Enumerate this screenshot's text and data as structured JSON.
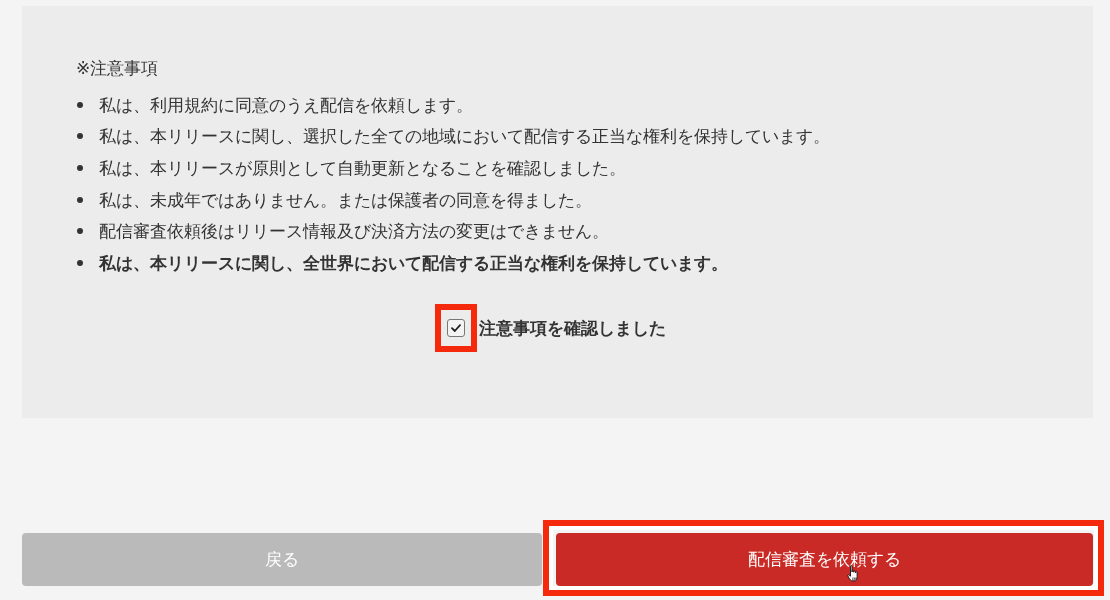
{
  "notice": {
    "title": "※注意事項",
    "items": [
      {
        "text": "私は、利用規約に同意のうえ配信を依頼します。",
        "bold": false
      },
      {
        "text": "私は、本リリースに関し、選択した全ての地域において配信する正当な権利を保持しています。",
        "bold": false
      },
      {
        "text": "私は、本リリースが原則として自動更新となることを確認しました。",
        "bold": false
      },
      {
        "text": "私は、未成年ではありません。または保護者の同意を得ました。",
        "bold": false
      },
      {
        "text": "配信審査依頼後はリリース情報及び決済方法の変更はできません。",
        "bold": false
      },
      {
        "text": "私は、本リリースに関し、全世界において配信する正当な権利を保持しています。",
        "bold": true
      }
    ],
    "confirm": {
      "label": "注意事項を確認しました",
      "checked": true,
      "highlighted": true
    }
  },
  "buttons": {
    "back": {
      "label": "戻る"
    },
    "submit": {
      "label": "配信審査を依頼する",
      "highlighted": true
    }
  }
}
